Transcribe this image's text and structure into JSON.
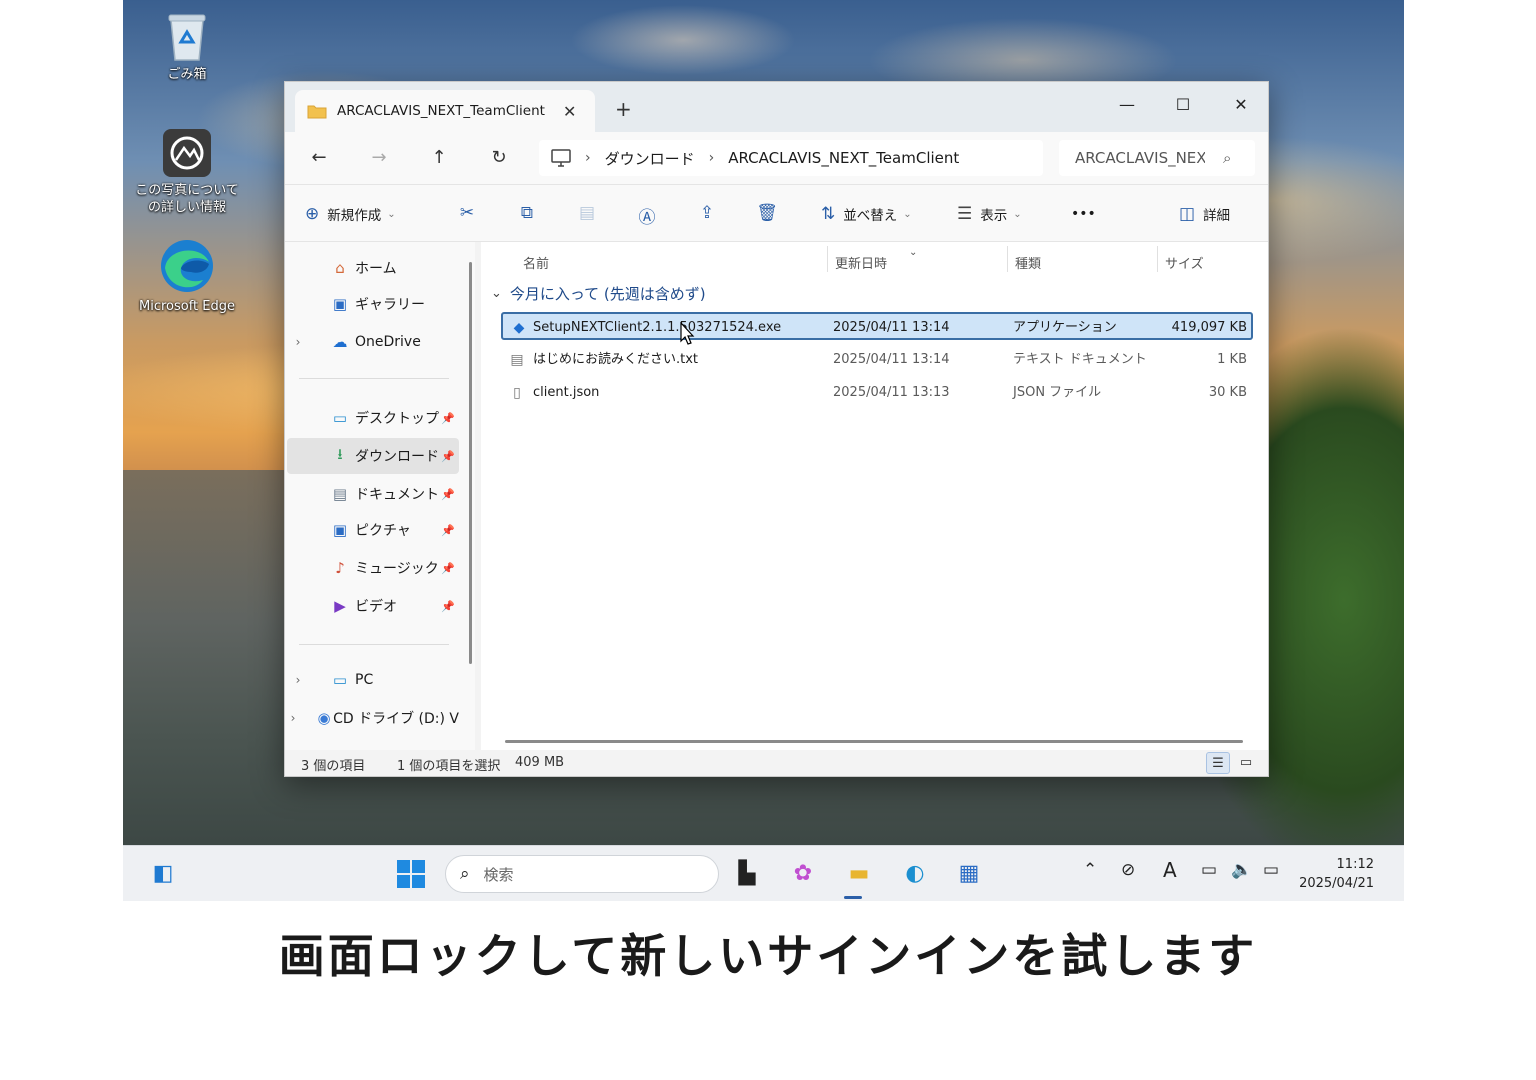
{
  "desktop": {
    "icons": [
      {
        "label": "ごみ箱",
        "icon": "recycle-bin-icon"
      },
      {
        "label": "この写真について の詳しい情報",
        "icon": "photo-info-icon"
      },
      {
        "label": "Microsoft Edge",
        "icon": "edge-icon"
      }
    ]
  },
  "explorer": {
    "tab_title": "ARCACLAVIS_NEXT_TeamClient",
    "tab_close": "✕",
    "new_tab": "+",
    "window_controls": {
      "minimize": "—",
      "maximize": "☐",
      "close": "✕"
    },
    "nav": {
      "back": "←",
      "forward": "→",
      "up": "↑",
      "refresh": "↻"
    },
    "address": {
      "crumbs": [
        "ダウンロード",
        "ARCACLAVIS_NEXT_TeamClient"
      ]
    },
    "search": {
      "text": "ARCACLAVIS_NEXT_TeamClient"
    },
    "commands": {
      "new": "新規作成",
      "sort": "並べ替え",
      "view": "表示",
      "more": "•••",
      "details": "詳細"
    },
    "sidebar": {
      "items": [
        {
          "label": "ホーム",
          "icon": "home-icon",
          "glyph": "⌂",
          "color": "#d4693a"
        },
        {
          "label": "ギャラリー",
          "icon": "gallery-icon",
          "glyph": "▣",
          "color": "#2b6cc4"
        },
        {
          "label": "OneDrive",
          "icon": "onedrive-icon",
          "glyph": "☁",
          "color": "#1f6fd0"
        },
        {
          "label": "デスクトップ",
          "icon": "desktop-icon",
          "glyph": "▭",
          "color": "#2a8fd0"
        },
        {
          "label": "ダウンロード",
          "icon": "download-icon",
          "glyph": "⭳",
          "color": "#2f9a5a"
        },
        {
          "label": "ドキュメント",
          "icon": "documents-icon",
          "glyph": "▤",
          "color": "#6b7b8c"
        },
        {
          "label": "ピクチャ",
          "icon": "pictures-icon",
          "glyph": "▣",
          "color": "#2b6cc4"
        },
        {
          "label": "ミュージック",
          "icon": "music-icon",
          "glyph": "♪",
          "color": "#d0503a"
        },
        {
          "label": "ビデオ",
          "icon": "video-icon",
          "glyph": "▶",
          "color": "#7a3ac4"
        },
        {
          "label": "PC",
          "icon": "pc-icon",
          "glyph": "▭",
          "color": "#2a8fd0"
        },
        {
          "label": "CD ドライブ (D:) V",
          "icon": "cd-drive-icon",
          "glyph": "◉",
          "color": "#3a7bd5"
        }
      ]
    },
    "columns": {
      "name": "名前",
      "modified": "更新日時",
      "type": "種類",
      "size": "サイズ"
    },
    "group_label": "今月に入って (先週は含めず)",
    "files": [
      {
        "name": "SetupNEXTClient2.1.1.503271524.exe",
        "modified": "2025/04/11 13:14",
        "type": "アプリケーション",
        "size": "419,097 KB",
        "icon": "setup-exe-icon"
      },
      {
        "name": "はじめにお読みください.txt",
        "modified": "2025/04/11 13:14",
        "type": "テキスト ドキュメント",
        "size": "1 KB",
        "icon": "text-file-icon"
      },
      {
        "name": "client.json",
        "modified": "2025/04/11 13:13",
        "type": "JSON ファイル",
        "size": "30 KB",
        "icon": "json-file-icon"
      }
    ],
    "status": {
      "count": "3 個の項目",
      "selected": "1 個の項目を選択",
      "selected_size": "409 MB"
    }
  },
  "taskbar": {
    "search_placeholder": "検索",
    "clock_time": "11:12",
    "clock_date": "2025/04/21",
    "input_indicator": "A"
  },
  "caption": "画面ロックして新しいサインインを試します"
}
